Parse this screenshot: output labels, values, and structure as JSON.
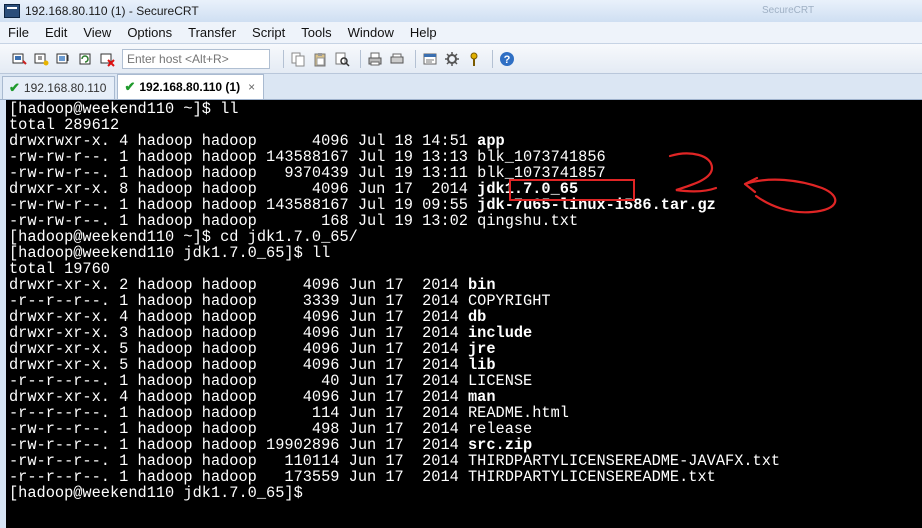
{
  "window": {
    "title": "192.168.80.110 (1) - SecureCRT",
    "hint": "SecureCRT"
  },
  "menu": [
    "File",
    "Edit",
    "View",
    "Options",
    "Transfer",
    "Script",
    "Tools",
    "Window",
    "Help"
  ],
  "toolbar": {
    "host_placeholder": "Enter host <Alt+R>",
    "buttons": [
      "connect-icon",
      "quick-connect-icon",
      "connect-tab-icon",
      "reconnect-icon",
      "disconnect-icon",
      "copy-icon",
      "paste-icon",
      "find-icon",
      "print-icon",
      "print-setup-icon",
      "session-options-icon",
      "global-options-icon",
      "keymap-icon",
      "help-icon"
    ]
  },
  "tabs": [
    {
      "label": "192.168.80.110",
      "active": false
    },
    {
      "label": "192.168.80.110 (1)",
      "active": true,
      "close": "×"
    }
  ],
  "terminal": {
    "lines": [
      {
        "segments": [
          {
            "t": "[hadoop@weekend110 ~]$ ll"
          }
        ]
      },
      {
        "segments": [
          {
            "t": "total 289612"
          }
        ]
      },
      {
        "segments": [
          {
            "t": "drwxrwxr-x. 4 hadoop hadoop      4096 Jul 18 14:51 "
          },
          {
            "t": "app",
            "b": true
          }
        ]
      },
      {
        "segments": [
          {
            "t": "-rw-rw-r--. 1 hadoop hadoop 143588167 Jul 19 13:13 blk_1073741856"
          }
        ]
      },
      {
        "segments": [
          {
            "t": "-rw-rw-r--. 1 hadoop hadoop   9370439 Jul 19 13:11 blk_1073741857"
          }
        ]
      },
      {
        "segments": [
          {
            "t": "drwxr-xr-x. 8 hadoop hadoop      4096 Jun 17  2014 "
          },
          {
            "t": "jdk1.7.0_65",
            "b": true
          }
        ]
      },
      {
        "segments": [
          {
            "t": "-rw-rw-r--. 1 hadoop hadoop 143588167 Jul 19 09:55 "
          },
          {
            "t": "jdk-7u65-linux-i586.tar.gz",
            "b": true
          }
        ]
      },
      {
        "segments": [
          {
            "t": "-rw-rw-r--. 1 hadoop hadoop       168 Jul 19 13:02 qingshu.txt"
          }
        ]
      },
      {
        "segments": [
          {
            "t": "[hadoop@weekend110 ~]$ cd jdk1.7.0_65/"
          }
        ]
      },
      {
        "segments": [
          {
            "t": "[hadoop@weekend110 jdk1.7.0_65]$ ll"
          }
        ]
      },
      {
        "segments": [
          {
            "t": "total 19760"
          }
        ]
      },
      {
        "segments": [
          {
            "t": "drwxr-xr-x. 2 hadoop hadoop     4096 Jun 17  2014 "
          },
          {
            "t": "bin",
            "b": true
          }
        ]
      },
      {
        "segments": [
          {
            "t": "-r--r--r--. 1 hadoop hadoop     3339 Jun 17  2014 COPYRIGHT"
          }
        ]
      },
      {
        "segments": [
          {
            "t": "drwxr-xr-x. 4 hadoop hadoop     4096 Jun 17  2014 "
          },
          {
            "t": "db",
            "b": true
          }
        ]
      },
      {
        "segments": [
          {
            "t": "drwxr-xr-x. 3 hadoop hadoop     4096 Jun 17  2014 "
          },
          {
            "t": "include",
            "b": true
          }
        ]
      },
      {
        "segments": [
          {
            "t": "drwxr-xr-x. 5 hadoop hadoop     4096 Jun 17  2014 "
          },
          {
            "t": "jre",
            "b": true
          }
        ]
      },
      {
        "segments": [
          {
            "t": "drwxr-xr-x. 5 hadoop hadoop     4096 Jun 17  2014 "
          },
          {
            "t": "lib",
            "b": true
          }
        ]
      },
      {
        "segments": [
          {
            "t": "-r--r--r--. 1 hadoop hadoop       40 Jun 17  2014 LICENSE"
          }
        ]
      },
      {
        "segments": [
          {
            "t": "drwxr-xr-x. 4 hadoop hadoop     4096 Jun 17  2014 "
          },
          {
            "t": "man",
            "b": true
          }
        ]
      },
      {
        "segments": [
          {
            "t": "-r--r--r--. 1 hadoop hadoop      114 Jun 17  2014 README.html"
          }
        ]
      },
      {
        "segments": [
          {
            "t": "-rw-r--r--. 1 hadoop hadoop      498 Jun 17  2014 release"
          }
        ]
      },
      {
        "segments": [
          {
            "t": "-rw-r--r--. 1 hadoop hadoop 19902896 Jun 17  2014 "
          },
          {
            "t": "src.zip",
            "b": true
          }
        ]
      },
      {
        "segments": [
          {
            "t": "-rw-r--r--. 1 hadoop hadoop   110114 Jun 17  2014 THIRDPARTYLICENSEREADME-JAVAFX.txt"
          }
        ]
      },
      {
        "segments": [
          {
            "t": "-r--r--r--. 1 hadoop hadoop   173559 Jun 17  2014 THIRDPARTYLICENSEREADME.txt"
          }
        ]
      },
      {
        "segments": [
          {
            "t": "[hadoop@weekend110 jdk1.7.0_65]$"
          }
        ]
      }
    ]
  },
  "colors": {
    "terminal_bg": "#000000",
    "terminal_fg": "#ffffff",
    "annotation": "#e02525",
    "tab_check": "#1f9a2c"
  }
}
